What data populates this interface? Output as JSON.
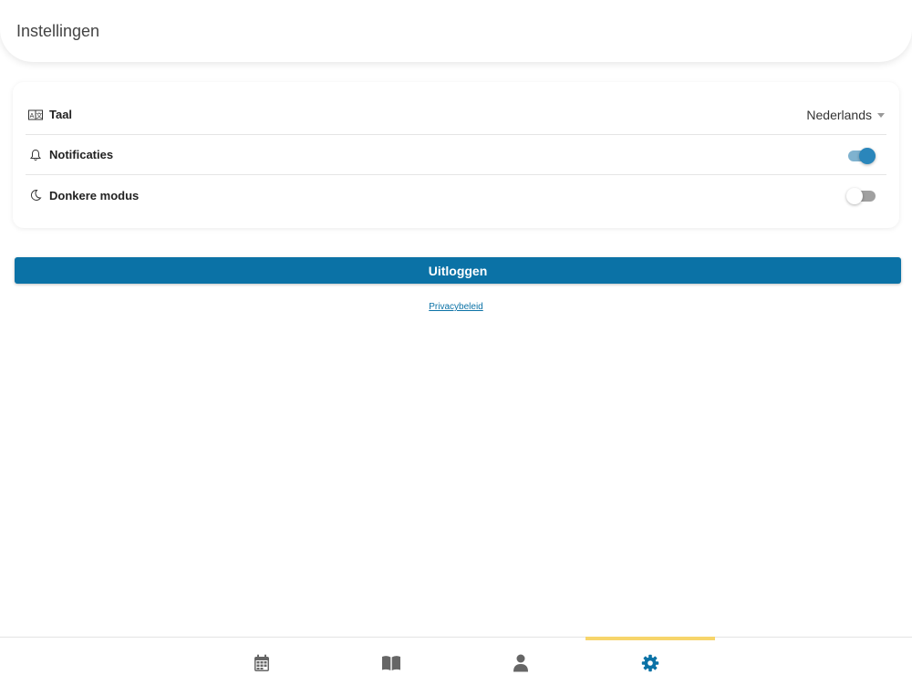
{
  "header": {
    "title": "Instellingen"
  },
  "settings": {
    "language": {
      "label": "Taal",
      "value": "Nederlands",
      "icon": "translate-icon"
    },
    "notifications": {
      "label": "Notificaties",
      "enabled": true,
      "icon": "bell-icon"
    },
    "dark_mode": {
      "label": "Donkere modus",
      "enabled": false,
      "icon": "moon-icon"
    }
  },
  "logout_label": "Uitloggen",
  "privacy_label": "Privacybeleid",
  "nav": {
    "items": [
      {
        "icon": "calendar-icon",
        "active": false
      },
      {
        "icon": "book-icon",
        "active": false
      },
      {
        "icon": "user-icon",
        "active": false
      },
      {
        "icon": "gear-icon",
        "active": true
      }
    ]
  },
  "colors": {
    "primary": "#0b72a6",
    "active_indicator": "#f7d56b",
    "inactive_icon": "#666666"
  }
}
